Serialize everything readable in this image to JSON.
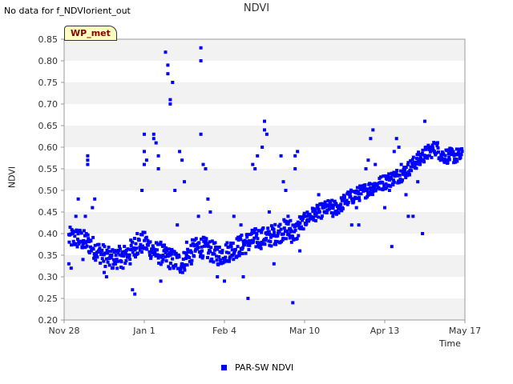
{
  "header": {
    "note": "No data for f_NDVIorient_out",
    "badge": "WP_met"
  },
  "chart_data": {
    "type": "scatter",
    "title": "NDVI",
    "xlabel": "Time",
    "ylabel": "NDVI",
    "ylim": [
      0.2,
      0.85
    ],
    "yticks": [
      0.2,
      0.25,
      0.3,
      0.35,
      0.4,
      0.45,
      0.5,
      0.55,
      0.6,
      0.65,
      0.7,
      0.75,
      0.8,
      0.85
    ],
    "xlim": [
      "2022-11-28",
      "2023-05-17"
    ],
    "xticks": [
      "Nov 28",
      "Jan 1",
      "Feb 4",
      "Mar 10",
      "Apr 13",
      "May 17"
    ],
    "grid": "alternating horizontal bands",
    "legend_position": "bottom-center",
    "colors": {
      "series": "#0000ff",
      "band": "#f2f2f2"
    },
    "series": [
      {
        "name": "PAR-SW NDVI",
        "x_start": "2022-11-28",
        "x_end": "2023-05-17",
        "trend_keypoints": [
          [
            0,
            0.39
          ],
          [
            5,
            0.39
          ],
          [
            10,
            0.38
          ],
          [
            14,
            0.36
          ],
          [
            20,
            0.34
          ],
          [
            26,
            0.35
          ],
          [
            30,
            0.37
          ],
          [
            34,
            0.38
          ],
          [
            38,
            0.36
          ],
          [
            42,
            0.35
          ],
          [
            46,
            0.34
          ],
          [
            50,
            0.33
          ],
          [
            54,
            0.36
          ],
          [
            58,
            0.37
          ],
          [
            62,
            0.36
          ],
          [
            66,
            0.35
          ],
          [
            70,
            0.36
          ],
          [
            74,
            0.37
          ],
          [
            78,
            0.38
          ],
          [
            82,
            0.39
          ],
          [
            86,
            0.39
          ],
          [
            90,
            0.4
          ],
          [
            94,
            0.41
          ],
          [
            98,
            0.4
          ],
          [
            100,
            0.42
          ],
          [
            104,
            0.44
          ],
          [
            108,
            0.45
          ],
          [
            112,
            0.46
          ],
          [
            116,
            0.46
          ],
          [
            120,
            0.48
          ],
          [
            124,
            0.49
          ],
          [
            128,
            0.5
          ],
          [
            132,
            0.51
          ],
          [
            136,
            0.52
          ],
          [
            140,
            0.53
          ],
          [
            144,
            0.54
          ],
          [
            148,
            0.56
          ],
          [
            152,
            0.58
          ],
          [
            155,
            0.59
          ],
          [
            158,
            0.6
          ],
          [
            160,
            0.58
          ]
        ],
        "outliers": [
          [
            2,
            0.33
          ],
          [
            3,
            0.32
          ],
          [
            5,
            0.44
          ],
          [
            6,
            0.48
          ],
          [
            8,
            0.34
          ],
          [
            9,
            0.44
          ],
          [
            10,
            0.57
          ],
          [
            10,
            0.56
          ],
          [
            10,
            0.58
          ],
          [
            12,
            0.46
          ],
          [
            13,
            0.48
          ],
          [
            17,
            0.31
          ],
          [
            18,
            0.3
          ],
          [
            22,
            0.35
          ],
          [
            25,
            0.32
          ],
          [
            28,
            0.33
          ],
          [
            29,
            0.27
          ],
          [
            30,
            0.26
          ],
          [
            31,
            0.4
          ],
          [
            33,
            0.5
          ],
          [
            34,
            0.63
          ],
          [
            34,
            0.59
          ],
          [
            34,
            0.56
          ],
          [
            35,
            0.57
          ],
          [
            38,
            0.63
          ],
          [
            38,
            0.62
          ],
          [
            39,
            0.61
          ],
          [
            40,
            0.58
          ],
          [
            40,
            0.55
          ],
          [
            41,
            0.38
          ],
          [
            41,
            0.29
          ],
          [
            42,
            0.35
          ],
          [
            43,
            0.82
          ],
          [
            44,
            0.79
          ],
          [
            44,
            0.77
          ],
          [
            45,
            0.71
          ],
          [
            45,
            0.7
          ],
          [
            46,
            0.75
          ],
          [
            47,
            0.5
          ],
          [
            48,
            0.42
          ],
          [
            49,
            0.59
          ],
          [
            50,
            0.57
          ],
          [
            51,
            0.52
          ],
          [
            52,
            0.38
          ],
          [
            54,
            0.33
          ],
          [
            57,
            0.44
          ],
          [
            58,
            0.63
          ],
          [
            58,
            0.8
          ],
          [
            58,
            0.83
          ],
          [
            59,
            0.56
          ],
          [
            60,
            0.55
          ],
          [
            61,
            0.48
          ],
          [
            62,
            0.45
          ],
          [
            65,
            0.3
          ],
          [
            68,
            0.29
          ],
          [
            72,
            0.44
          ],
          [
            75,
            0.42
          ],
          [
            76,
            0.3
          ],
          [
            78,
            0.25
          ],
          [
            80,
            0.56
          ],
          [
            81,
            0.55
          ],
          [
            82,
            0.58
          ],
          [
            84,
            0.6
          ],
          [
            85,
            0.64
          ],
          [
            85,
            0.66
          ],
          [
            86,
            0.63
          ],
          [
            87,
            0.45
          ],
          [
            89,
            0.33
          ],
          [
            92,
            0.58
          ],
          [
            93,
            0.52
          ],
          [
            94,
            0.5
          ],
          [
            95,
            0.44
          ],
          [
            96,
            0.43
          ],
          [
            97,
            0.24
          ],
          [
            98,
            0.58
          ],
          [
            98,
            0.55
          ],
          [
            99,
            0.59
          ],
          [
            100,
            0.36
          ],
          [
            103,
            0.44
          ],
          [
            108,
            0.49
          ],
          [
            110,
            0.46
          ],
          [
            114,
            0.44
          ],
          [
            118,
            0.46
          ],
          [
            122,
            0.42
          ],
          [
            124,
            0.46
          ],
          [
            125,
            0.42
          ],
          [
            128,
            0.55
          ],
          [
            129,
            0.57
          ],
          [
            130,
            0.62
          ],
          [
            131,
            0.64
          ],
          [
            132,
            0.56
          ],
          [
            136,
            0.46
          ],
          [
            138,
            0.5
          ],
          [
            139,
            0.37
          ],
          [
            140,
            0.59
          ],
          [
            141,
            0.62
          ],
          [
            142,
            0.6
          ],
          [
            143,
            0.56
          ],
          [
            145,
            0.49
          ],
          [
            146,
            0.44
          ],
          [
            148,
            0.44
          ],
          [
            150,
            0.52
          ],
          [
            151,
            0.56
          ],
          [
            152,
            0.4
          ],
          [
            153,
            0.66
          ]
        ]
      }
    ]
  }
}
